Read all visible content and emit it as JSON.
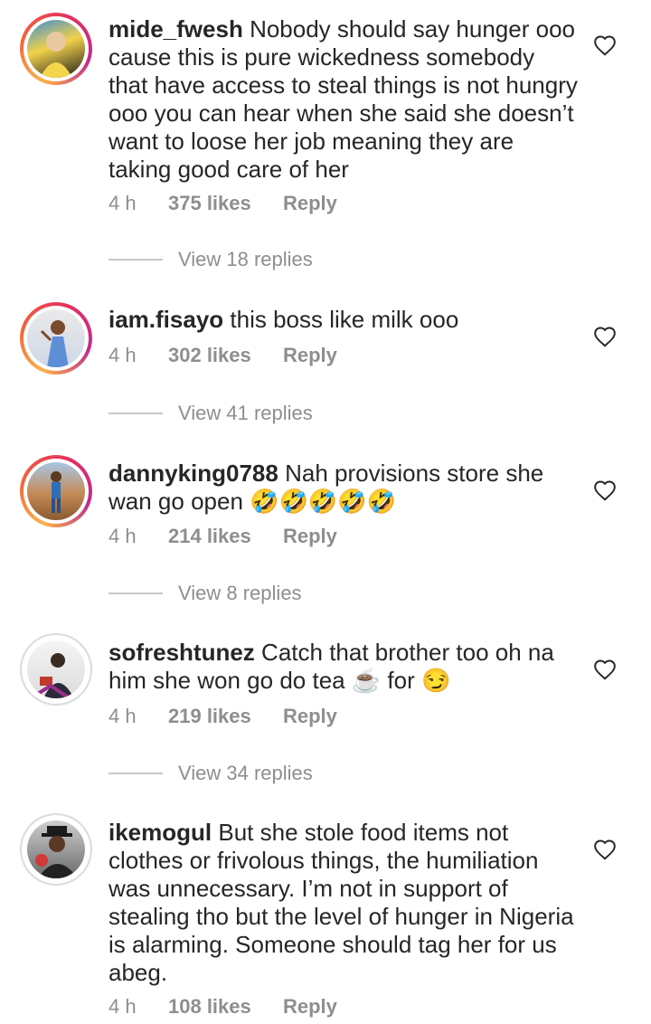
{
  "comments": [
    {
      "username": "mide_fwesh",
      "text": "Nobody should say hunger ooo cause this is pure wickedness somebody that have access to steal things is not hungry ooo you can hear when she said she doesn’t want to loose her job meaning they are taking good care of her",
      "time": "4 h",
      "likes": "375 likes",
      "reply": "Reply",
      "view_replies": "View 18 replies"
    },
    {
      "username": "iam.fisayo",
      "text": "this boss like milk ooo",
      "time": "4 h",
      "likes": "302 likes",
      "reply": "Reply",
      "view_replies": "View 41 replies"
    },
    {
      "username": "dannyking0788",
      "text": "Nah provisions store she wan go open 🤣🤣🤣🤣🤣",
      "time": "4 h",
      "likes": "214 likes",
      "reply": "Reply",
      "view_replies": "View 8 replies"
    },
    {
      "username": "sofreshtunez",
      "text": "Catch that brother too oh na him she won go do tea ☕ for 😏",
      "time": "4 h",
      "likes": "219 likes",
      "reply": "Reply",
      "view_replies": "View 34 replies"
    },
    {
      "username": "ikemogul",
      "text": "But she stole food items not clothes or frivolous things, the humiliation was unnecessary. I’m not in support of stealing tho but the level of hunger in Nigeria is alarming. Someone should tag her for us abeg.",
      "time": "4 h",
      "likes": "108 likes",
      "reply": "Reply"
    }
  ],
  "icons": {
    "like": "heart-outline-icon"
  },
  "colors": {
    "text": "#262626",
    "secondary": "#8e8e8e",
    "story_ring": "#e5305e"
  }
}
